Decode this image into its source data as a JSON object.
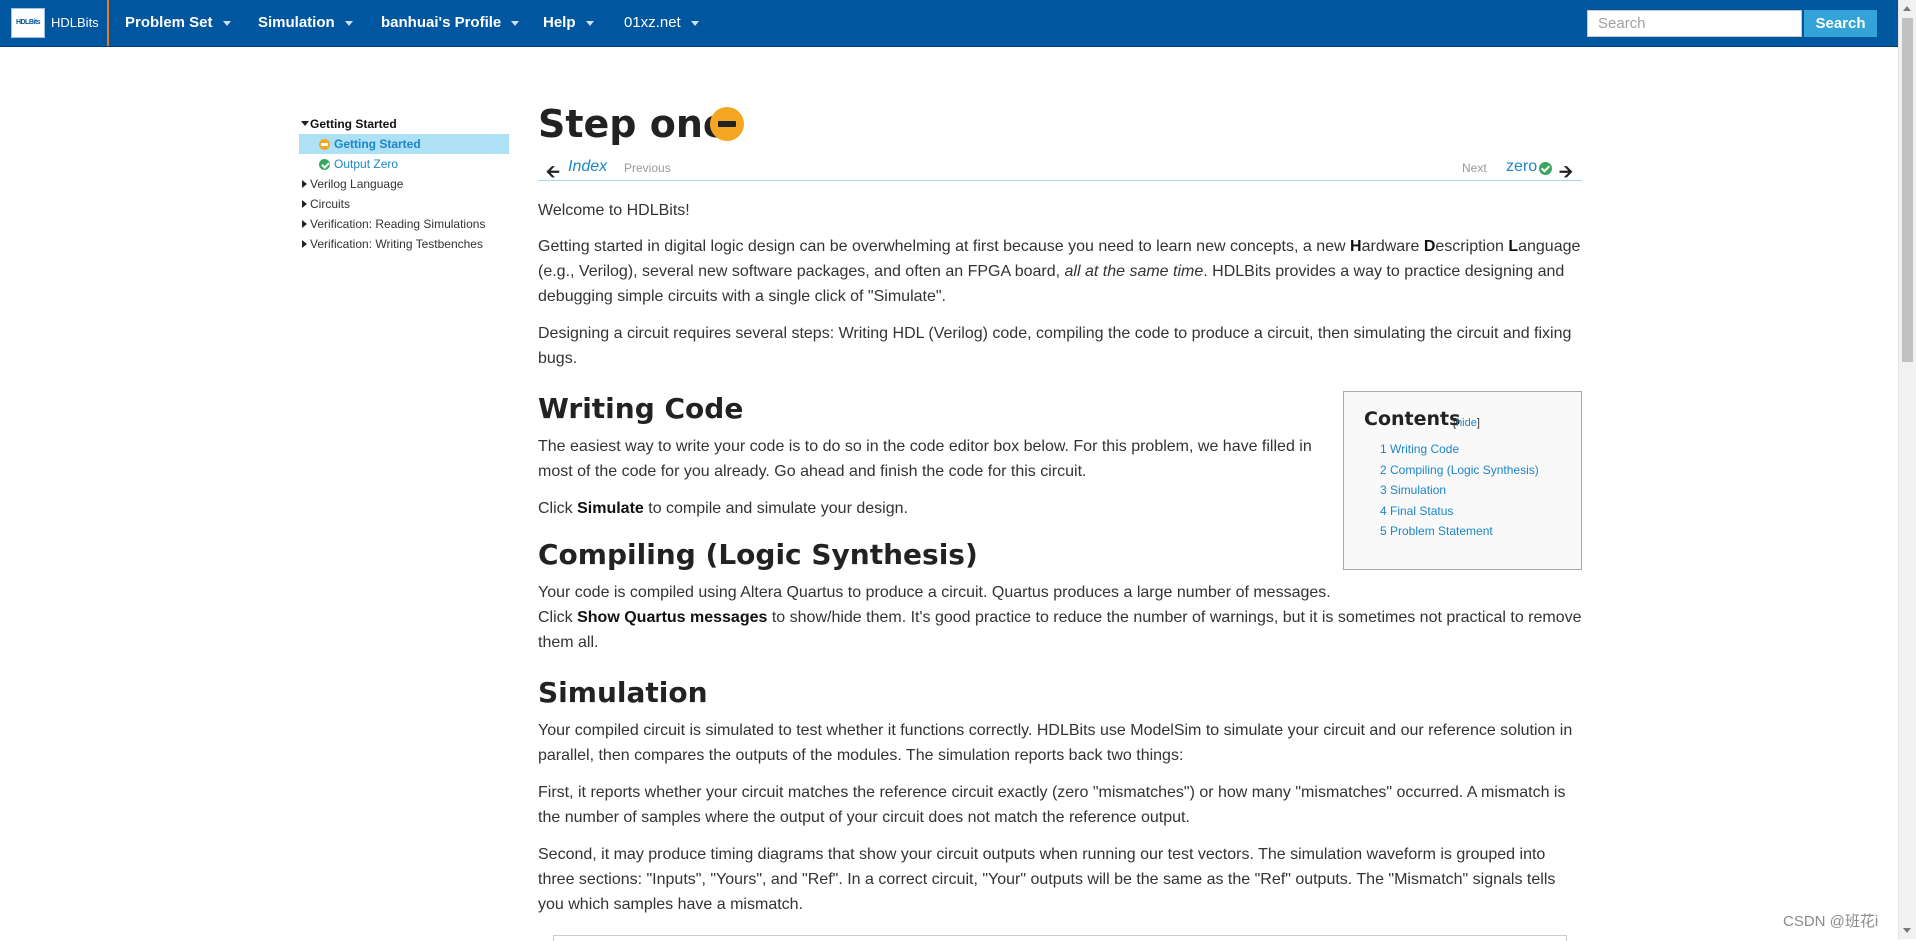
{
  "navbar": {
    "brand": {
      "logo_text": "HDLBits",
      "name": "HDLBits"
    },
    "items": [
      {
        "label": "Problem Set"
      },
      {
        "label": "Simulation"
      },
      {
        "label": "banhuai's Profile"
      },
      {
        "label": "Help"
      },
      {
        "label": "01xz.net"
      }
    ],
    "search": {
      "placeholder": "Search",
      "button": "Search"
    }
  },
  "sidebar": {
    "items": [
      {
        "label": "Getting Started"
      },
      {
        "label": "Getting Started"
      },
      {
        "label": "Output Zero"
      },
      {
        "label": "Verilog Language"
      },
      {
        "label": "Circuits"
      },
      {
        "label": "Verification: Reading Simulations"
      },
      {
        "label": "Verification: Writing Testbenches"
      }
    ]
  },
  "page": {
    "title": "Step one",
    "pager": {
      "index": "Index",
      "previous": "Previous",
      "next": "Next",
      "next_link": "zero"
    },
    "intro": "Welcome to HDLBits!",
    "p1": {
      "a": "Getting started in digital logic design can be overwhelming at first because you need to learn new concepts, a new ",
      "h": "H",
      "ardware": "ardware ",
      "d": "D",
      "escription": "escription ",
      "l": "L",
      "anguage": "anguage (e.g., Verilog), several new software packages, and often an FPGA board, ",
      "em": "all at the same time",
      "b": ". HDLBits provides a way to practice designing and debugging simple circuits with a single click of \"Simulate\"."
    },
    "p2": "Designing a circuit requires several steps: Writing HDL (Verilog) code, compiling the code to produce a circuit, then simulating the circuit and fixing bugs.",
    "sections": {
      "writing": {
        "heading": "Writing Code",
        "p1": "The easiest way to write your code is to do so in the code editor box below. For this problem, we have filled in most of the code for you already. Go ahead and finish the code for this circuit.",
        "p2_a": "Click ",
        "p2_b": "Simulate",
        "p2_c": " to compile and simulate your design."
      },
      "compiling": {
        "heading": "Compiling (Logic Synthesis)",
        "line1": "Your code is compiled using Altera Quartus to produce a circuit. Quartus produces a large number of messages.",
        "line2_a": "Click ",
        "line2_b": "Show Quartus messages",
        "line2_c": " to show/hide them. It's good practice to reduce the number of warnings, but it is sometimes not practical to remove them all."
      },
      "simulation": {
        "heading": "Simulation",
        "p1": "Your compiled circuit is simulated to test whether it functions correctly. HDLBits use ModelSim to simulate your circuit and our reference solution in parallel, then compares the outputs of the modules. The simulation reports back two things:",
        "p2": "First, it reports whether your circuit matches the reference circuit exactly (zero \"mismatches\") or how many \"mismatches\" occurred. A mismatch is the number of samples where the output of your circuit does not match the reference output.",
        "p3": "Second, it may produce timing diagrams that show your circuit outputs when running our test vectors. The simulation waveform is grouped into three sections: \"Inputs\", \"Yours\", and \"Ref\". In a correct circuit, \"Your\" outputs will be the same as the \"Ref\" outputs. The \"Mismatch\" signals tells you which samples have a mismatch."
      }
    },
    "toc": {
      "title": "Contents",
      "bracket_open": "[",
      "hide": "hide",
      "bracket_close": "]",
      "items": [
        "1 Writing Code",
        "2 Compiling (Logic Synthesis)",
        "3 Simulation",
        "4 Final Status",
        "5 Problem Statement"
      ]
    }
  },
  "watermark": "CSDN @班花i",
  "colors": {
    "navbar": "#00569f",
    "accent": "#1c86c8",
    "search_button": "#33a3d8",
    "status_attempted": "#f5a623",
    "status_solved": "#3aa75e",
    "sidebar_active": "#aee0f6"
  },
  "icons": {
    "status_attempted": "minus-circle-icon",
    "status_solved": "check-circle-icon",
    "arrow_left": "arrow-left-icon",
    "arrow_right": "arrow-right-icon"
  }
}
